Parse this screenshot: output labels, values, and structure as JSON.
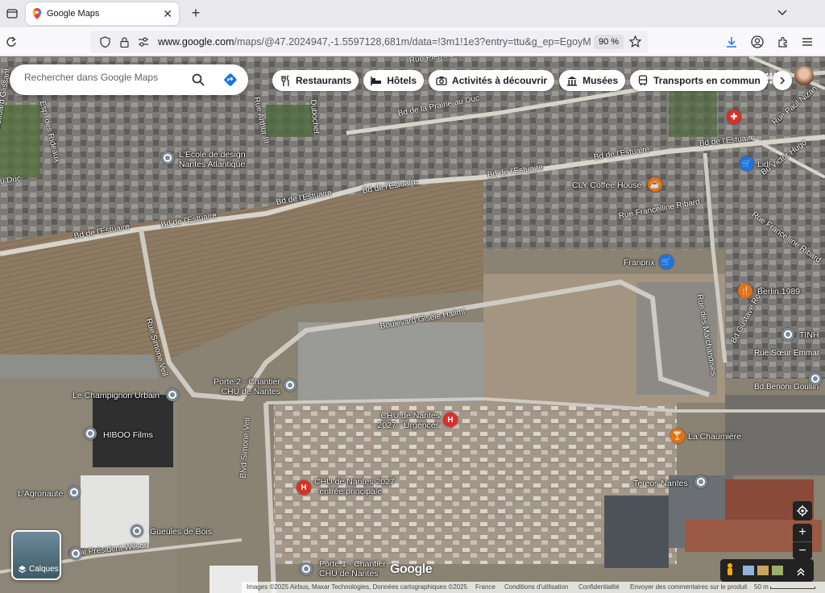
{
  "browser": {
    "tab_title": "Google Maps",
    "url_domain": "www.google.com",
    "url_rest": "/maps/@47.2024947,-1.5597128,681m/data=!3m1!1e3?entry=ttu&g_ep=EgoyM",
    "zoom": "90 %"
  },
  "search": {
    "placeholder": "Rechercher dans Google Maps"
  },
  "chips": [
    "Restaurants",
    "Hôtels",
    "Activités à découvrir",
    "Musées",
    "Transports en commun"
  ],
  "places": {
    "ecole": "L'École de design Nantes Atlantique",
    "cly": "CLY Coffee House",
    "franprix": "Franprix",
    "lidl": "Lidl",
    "berlin": "Berlin 1989",
    "tinh": "TINH",
    "porte2": "Porte 2 - Chantier CHU de Nantes",
    "champignon": "Le Champignon Urbain",
    "hiboo": "HIBOO Films",
    "chu_urgences": "CHU de Nantes 2027 - Urgences",
    "chu_entree": "CHU de Nantes 2027 - entrée principale",
    "agronaute": "L'Agronaute",
    "gueules": "Gueules de Bois",
    "porte1": "Porte 1 - Chantier CHU de Nantes",
    "chaumiere": "La Chaumière",
    "tereos": "Tereos Nantes"
  },
  "roads": {
    "pierre_landais": "Rue Pierre Landais",
    "prairie": "Bd de la Prairie au Duc",
    "estuaire1": "Bd de l'Estuaire",
    "estuaire2": "Bd de l'Estuaire",
    "estuaire3": "Bd de l'Estuaire",
    "estuaire4": "Bd de l'Estuaire",
    "estuaire5": "Bd de l'Estuaire",
    "estuaire6": "Bd de l'Estuaire",
    "arthur": "Rue Arthur III",
    "dubochet": "Dubochet",
    "francelline1": "Rue Francelline Ribard",
    "francelline2": "Rue Francelline Ribard",
    "victor_hugo": "Bd Victor Hugo",
    "paul_nizan": "Rue Paul Nizan",
    "marchandises": "Rue des Marchandises",
    "gustave_roch": "Bd Gustave Roch",
    "soeur_emmanuelle": "Rue Sœur Emmar",
    "benoni": "Bd Benoni Goullin",
    "gisele": "Boulevard Gisèle Halimi",
    "simone_veil": "Rue Simone Veil",
    "bd_simone_veil": "Blvd Simone-Veil",
    "quai_wilson": "Quai Président Wilson",
    "edouard": "Bd Édouard Glissant",
    "duc": "u Duc",
    "rideaux": "Esp. des Rideaux"
  },
  "layers_label": "Calques",
  "logo": "Google",
  "footer": {
    "credits": "Images ©2025 Airbus, Maxar Technologies, Données cartographiques ©2025",
    "country": "France",
    "terms": "Conditions d'utilisation",
    "privacy": "Confidentialité",
    "feedback": "Envoyer des commentaires sur le produit",
    "scale": "50 m"
  }
}
